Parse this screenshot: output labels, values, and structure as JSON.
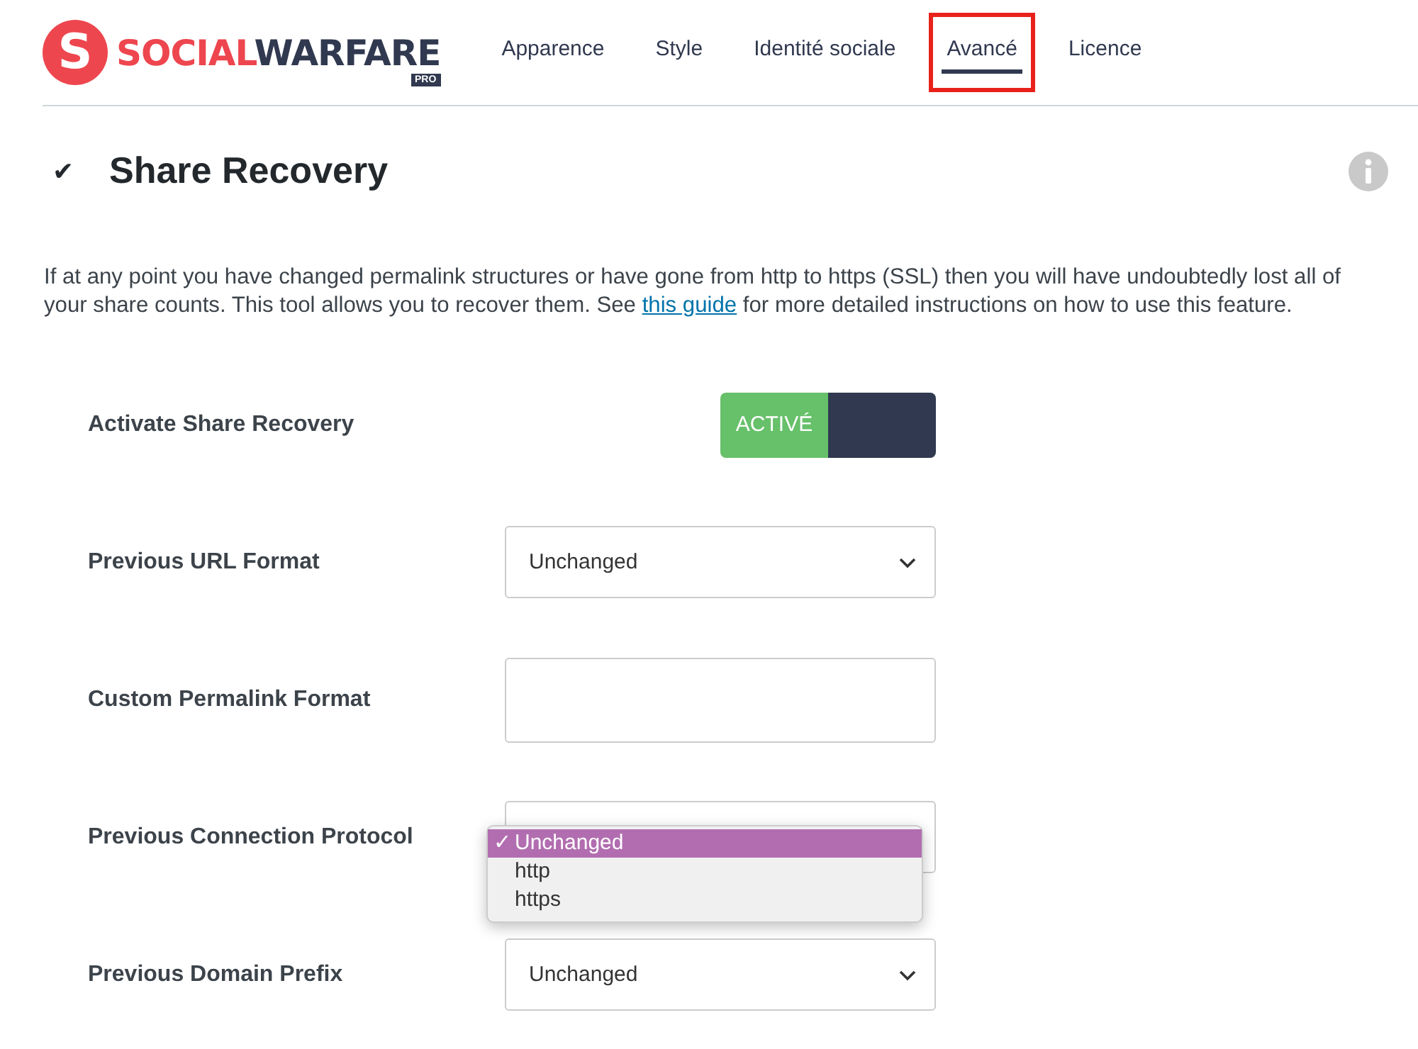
{
  "logo": {
    "initial": "S",
    "word_1": "SOCIAL",
    "word_2": "WARFARE",
    "badge": "PRO"
  },
  "tabs": [
    {
      "label": "Apparence",
      "selected": false
    },
    {
      "label": "Style",
      "selected": false
    },
    {
      "label": "Identité sociale",
      "selected": false
    },
    {
      "label": "Avancé",
      "selected": true,
      "highlighted": true
    },
    {
      "label": "Licence",
      "selected": false
    }
  ],
  "section": {
    "check": "✔",
    "title": "Share Recovery",
    "description_before": "If at any point you have changed permalink structures or have gone from http to https (SSL) then you will have undoubtedly lost all of your share counts. This tool allows you to recover them. See ",
    "link": "this guide",
    "description_after": " for more detailed instructions on how to use this feature."
  },
  "settings": [
    {
      "kind": "toggle",
      "label": "Activate Share Recovery",
      "on": true,
      "state_text": "ACTIVÉ"
    },
    {
      "kind": "select",
      "label": "Previous URL Format",
      "value": "Unchanged"
    },
    {
      "kind": "text",
      "label": "Custom Permalink Format"
    },
    {
      "kind": "open-select",
      "label": "Previous Connection Protocol",
      "tick": "✓",
      "options": [
        {
          "label": "Unchanged",
          "selected": true
        },
        {
          "label": "http",
          "selected": false
        },
        {
          "label": "https",
          "selected": false
        }
      ]
    },
    {
      "kind": "select",
      "label": "Previous Domain Prefix",
      "value": "Unchanged"
    }
  ]
}
